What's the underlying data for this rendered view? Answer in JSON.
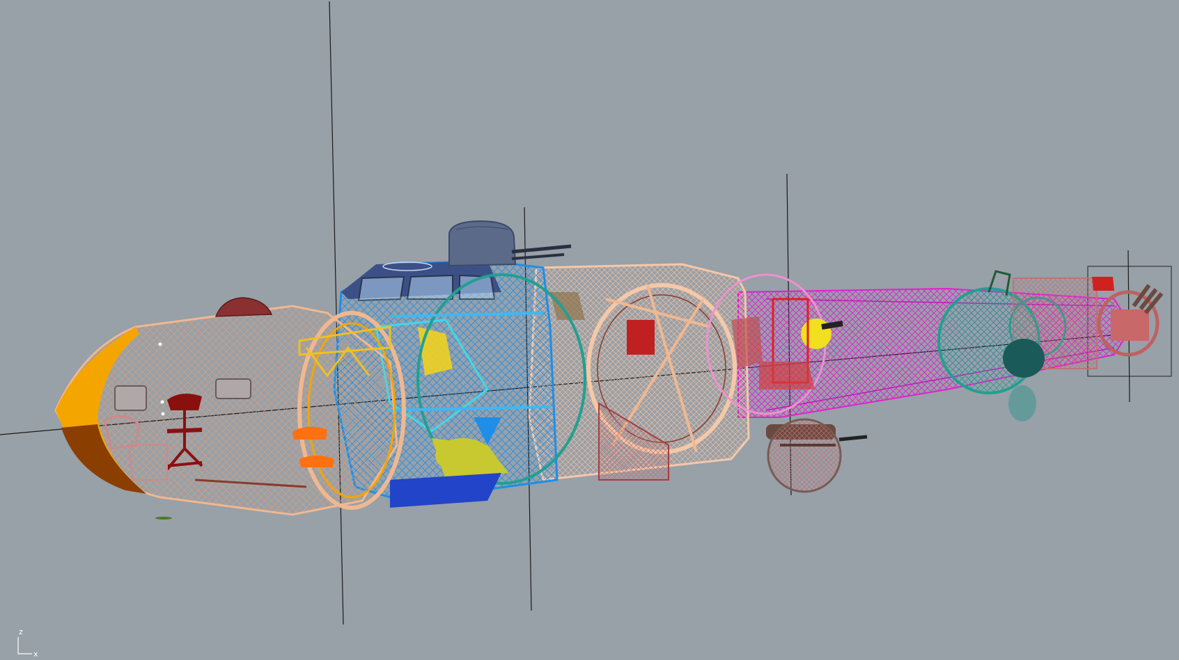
{
  "viewport": {
    "background": "#98a0a8",
    "gizmo": {
      "z_label": "z",
      "x_label": "x"
    }
  },
  "colors": {
    "nose": "#f5a500",
    "nose_dark": "#8a3e00",
    "fuselage_tan": "#f0b890",
    "fuselage_peach": "#f5c8a8",
    "blue": "#1e8ee8",
    "navy": "#3c5088",
    "cyan": "#40d8e8",
    "yellow": "#f0d020",
    "magenta": "#e020d0",
    "teal": "#20a090",
    "maroon": "#8a1010",
    "orange": "#ff7010",
    "rose": "#d08888",
    "lime": "#c8c830"
  }
}
